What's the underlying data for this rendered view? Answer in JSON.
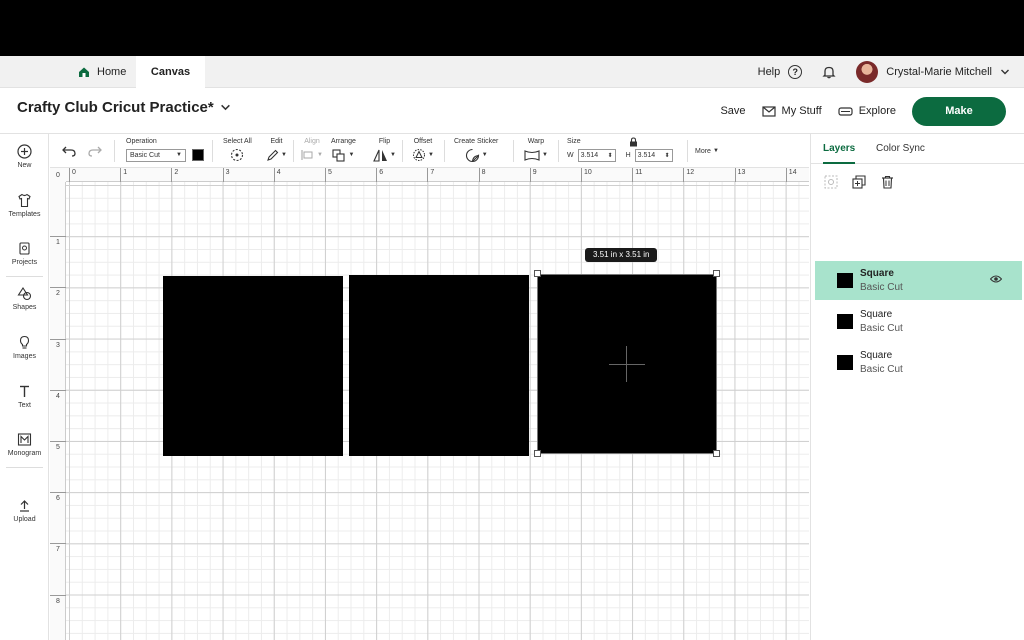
{
  "nav": {
    "home_label": "Home",
    "canvas_label": "Canvas",
    "help_label": "Help",
    "user_name": "Crystal-Marie Mitchell"
  },
  "titlebar": {
    "project_title": "Crafty Club Cricut Practice*",
    "save_label": "Save",
    "my_stuff_label": "My Stuff",
    "explore_label": "Explore",
    "make_label": "Make"
  },
  "sidebar": {
    "items": [
      {
        "label": "New",
        "icon": "plus-circle-icon"
      },
      {
        "label": "Templates",
        "icon": "shirt-icon"
      },
      {
        "label": "Projects",
        "icon": "projects-icon"
      },
      {
        "label": "Shapes",
        "icon": "shapes-icon"
      },
      {
        "label": "Images",
        "icon": "lightbulb-icon"
      },
      {
        "label": "Text",
        "icon": "text-icon"
      },
      {
        "label": "Monogram",
        "icon": "monogram-icon"
      },
      {
        "label": "Upload",
        "icon": "upload-icon"
      }
    ]
  },
  "toolbar": {
    "operation_label": "Operation",
    "operation_value": "Basic Cut",
    "select_all_label": "Select All",
    "edit_label": "Edit",
    "align_label": "Align",
    "arrange_label": "Arrange",
    "flip_label": "Flip",
    "offset_label": "Offset",
    "create_sticker_label": "Create Sticker",
    "warp_label": "Warp",
    "size_label": "Size",
    "w_label": "W",
    "w_value": "3.514",
    "h_label": "H",
    "h_value": "3.514",
    "more_label": "More"
  },
  "canvas": {
    "ruler_top": [
      "0",
      "1",
      "2",
      "3",
      "4",
      "5",
      "6",
      "7",
      "8",
      "9",
      "10",
      "11",
      "12",
      "13",
      "14"
    ],
    "ruler_left": [
      "1",
      "2",
      "3",
      "4",
      "5",
      "6",
      "7",
      "8"
    ],
    "ruler_origin": "0",
    "dimension_tooltip": "3.51  in x 3.51  in",
    "shape_color": "#000000"
  },
  "rpanel": {
    "tabs": [
      "Layers",
      "Color Sync"
    ],
    "layers": [
      {
        "name": "Square",
        "operation": "Basic Cut",
        "selected": true
      },
      {
        "name": "Square",
        "operation": "Basic Cut",
        "selected": false
      },
      {
        "name": "Square",
        "operation": "Basic Cut",
        "selected": false
      }
    ]
  },
  "colors": {
    "accent": "#0c6b40",
    "selected_layer": "#a8e3cc"
  }
}
